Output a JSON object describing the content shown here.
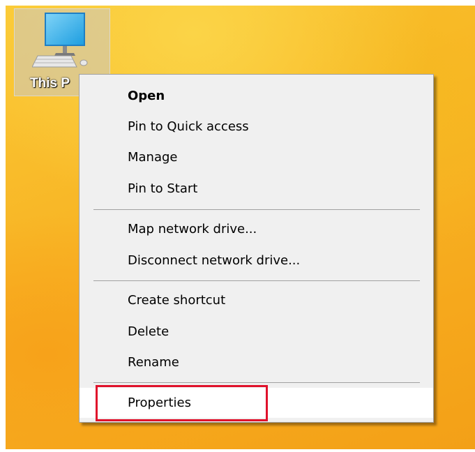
{
  "desktop": {
    "icon": {
      "name": "computer-monitor-icon",
      "label": "This P"
    }
  },
  "context_menu": {
    "items": [
      {
        "label": "Open",
        "bold": true
      },
      {
        "label": "Pin to Quick access"
      },
      {
        "label": "Manage"
      },
      {
        "label": "Pin to Start"
      },
      {
        "label": "Map network drive..."
      },
      {
        "label": "Disconnect network drive..."
      },
      {
        "label": "Create shortcut"
      },
      {
        "label": "Delete"
      },
      {
        "label": "Rename"
      },
      {
        "label": "Properties",
        "highlighted": true
      }
    ]
  },
  "colors": {
    "wallpaper": "#f8b626",
    "menu_background": "#f0f0f0",
    "menu_border": "#a0a0a0",
    "annotation_box": "#e0112b"
  }
}
